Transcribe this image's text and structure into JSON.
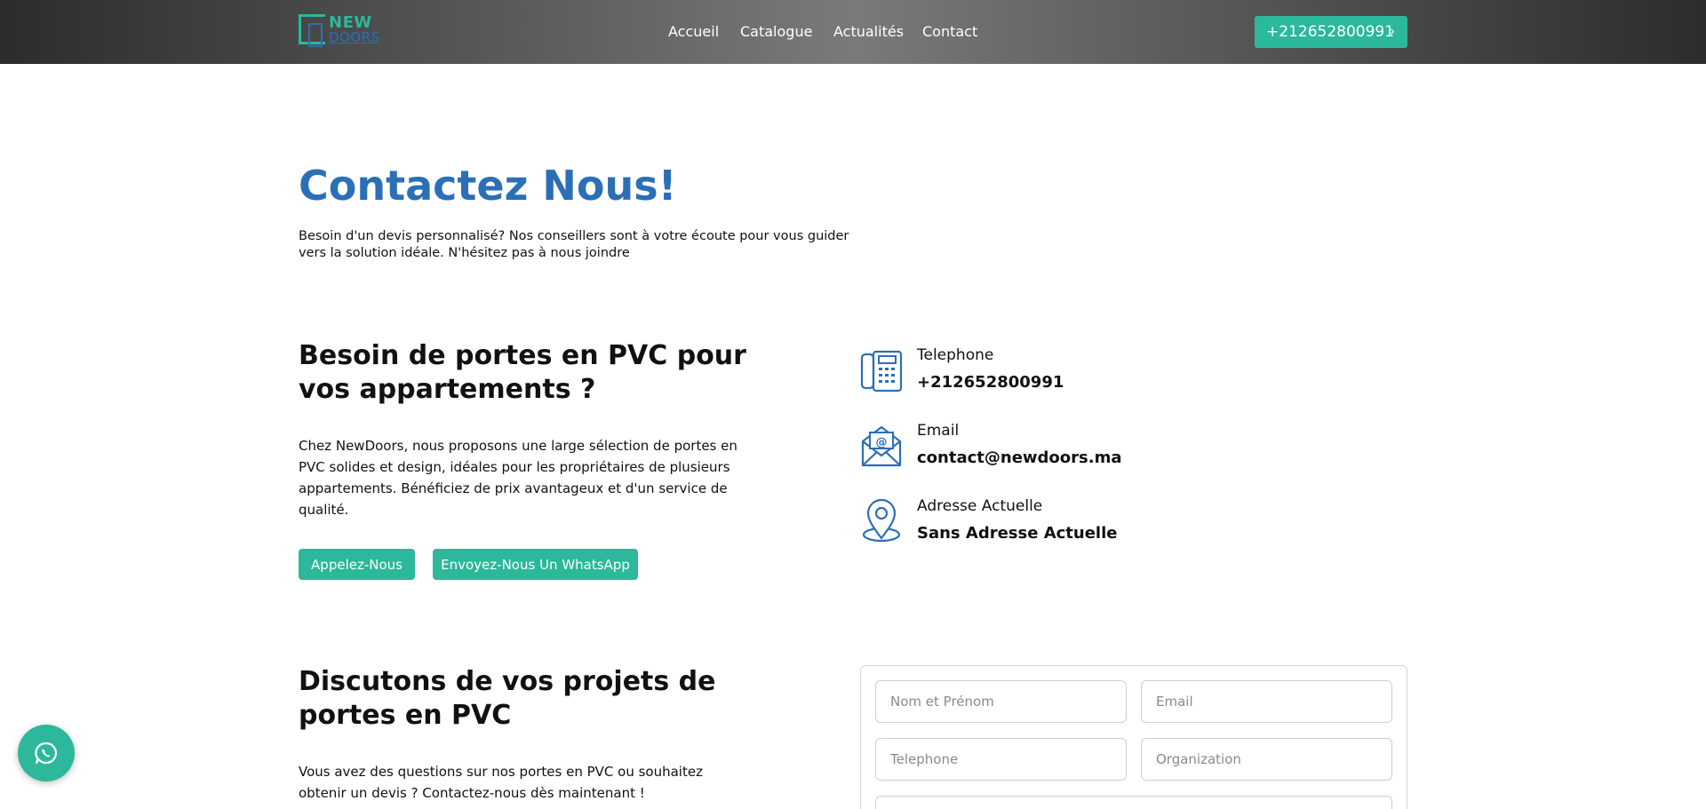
{
  "header": {
    "logo": {
      "top": "NEW",
      "bottom": "DOORS"
    },
    "nav": [
      "Accueil",
      "Catalogue",
      "Actualités",
      "Contact"
    ],
    "phone_button": "+212652800991"
  },
  "hero": {
    "title": "Contactez Nous!",
    "description": "Besoin d'un devis personnalisé? Nos conseillers sont à votre écoute pour vous guider vers la solution idéale. N'hésitez pas à nous joindre"
  },
  "section1": {
    "title": "Besoin de portes en PVC pour vos appartements ?",
    "description": "Chez NewDoors, nous proposons une large sélection de portes en PVC solides et design, idéales pour les propriétaires de plusieurs appartements. Bénéficiez de prix avantageux et d'un service de qualité.",
    "call_button": "Appelez-Nous",
    "whatsapp_button": "Envoyez-Nous Un WhatsApp"
  },
  "contact_info": {
    "phone_label": "Telephone",
    "phone_value": "+212652800991",
    "email_label": "Email",
    "email_value": "contact@newdoors.ma",
    "address_label": "Adresse Actuelle",
    "address_value": "Sans Adresse Actuelle"
  },
  "section2": {
    "title": "Discutons de vos projets de portes en PVC",
    "description": "Vous avez des questions sur nos portes en PVC ou souhaitez obtenir un devis ? Contactez-nous dès maintenant !"
  },
  "form": {
    "name_placeholder": "Nom et Prénom",
    "email_placeholder": "Email",
    "phone_placeholder": "Telephone",
    "organization_placeholder": "Organization"
  },
  "colors": {
    "accent": "#2cb89a",
    "brand_blue": "#2b6fb6"
  },
  "icons": [
    "phone-icon",
    "email-icon",
    "location-pin-icon",
    "whatsapp-icon",
    "chevron-right-icon"
  ]
}
